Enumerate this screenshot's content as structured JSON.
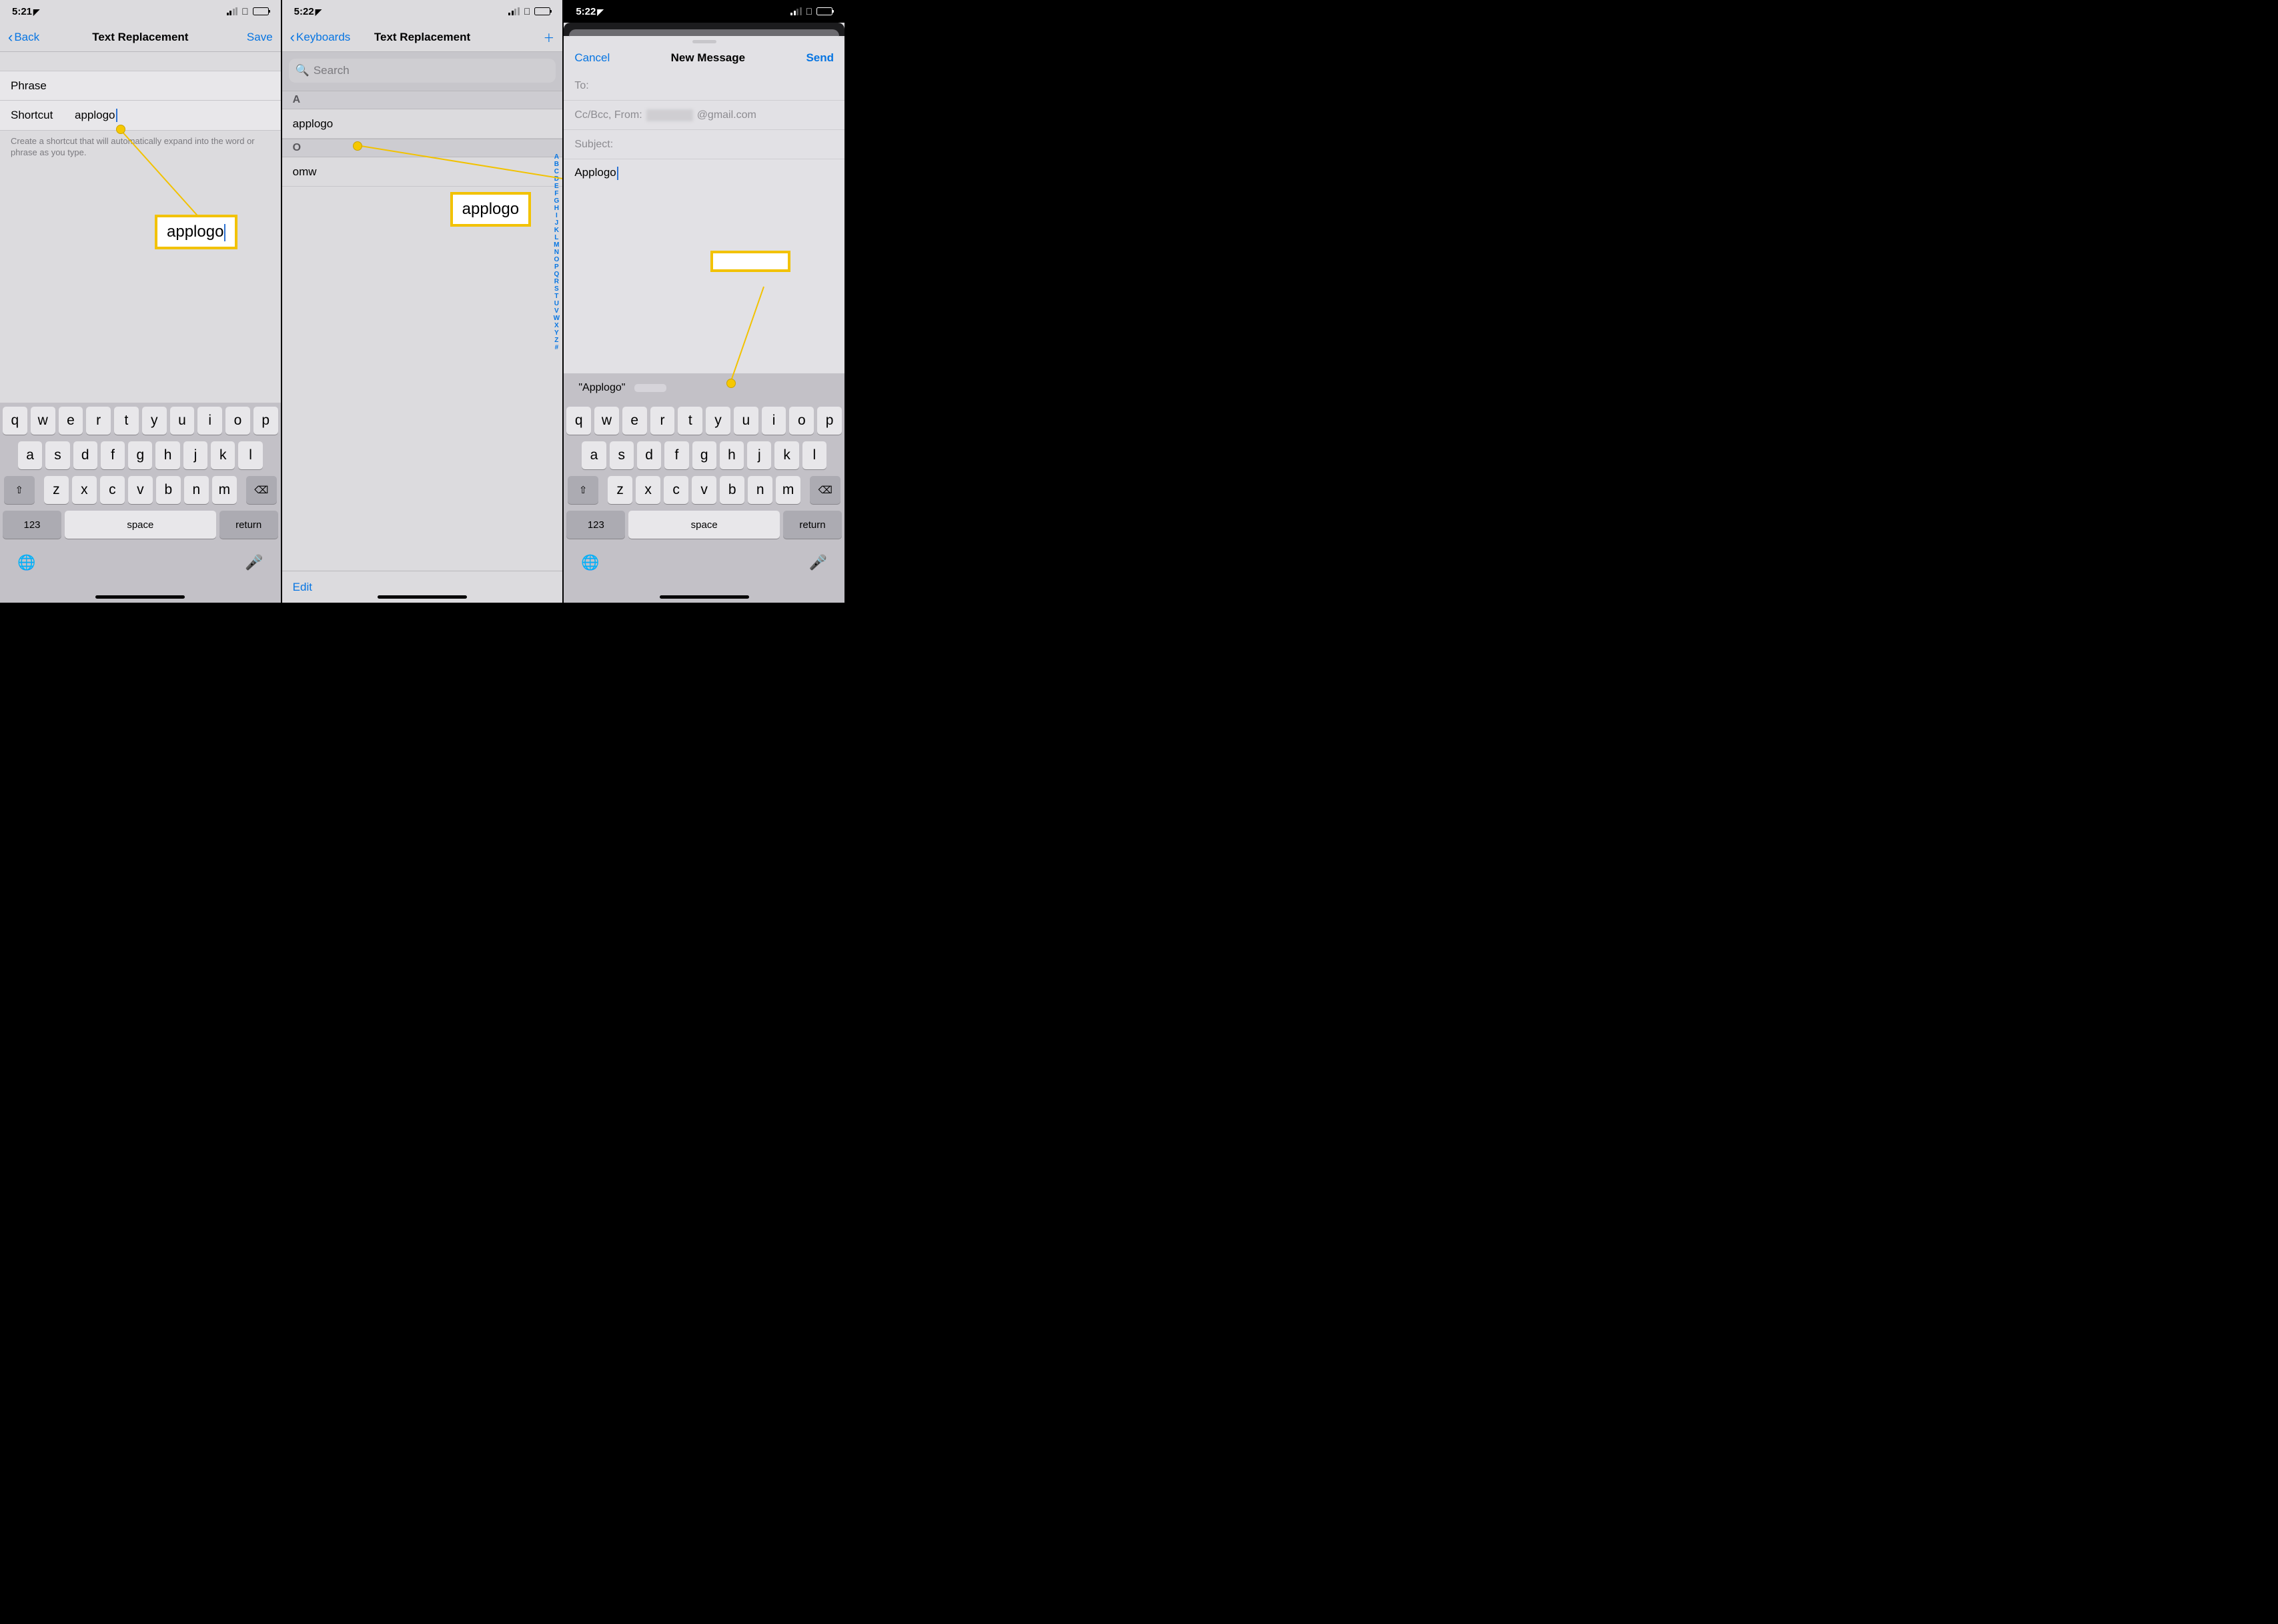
{
  "panel1": {
    "status_time": "5:21",
    "nav_back": "Back",
    "nav_title": "Text Replacement",
    "nav_save": "Save",
    "label_phrase": "Phrase",
    "value_phrase": "",
    "label_shortcut": "Shortcut",
    "value_shortcut": "applogo",
    "hint": "Create a shortcut that will automatically expand into the word or phrase as you type.",
    "callout_text": "applogo"
  },
  "panel2": {
    "status_time": "5:22",
    "nav_back": "Keyboards",
    "nav_title": "Text Replacement",
    "search_placeholder": "Search",
    "sections": [
      {
        "letter": "A",
        "rows": [
          {
            "shortcut": "applogo",
            "phrase": ""
          }
        ]
      },
      {
        "letter": "O",
        "rows": [
          {
            "shortcut": "omw",
            "phrase": ""
          }
        ]
      }
    ],
    "edit": "Edit",
    "index": [
      "A",
      "B",
      "C",
      "D",
      "E",
      "F",
      "G",
      "H",
      "I",
      "J",
      "K",
      "L",
      "M",
      "N",
      "O",
      "P",
      "Q",
      "R",
      "S",
      "T",
      "U",
      "V",
      "W",
      "X",
      "Y",
      "Z",
      "#"
    ],
    "callout_text": "applogo"
  },
  "panel3": {
    "status_time": "5:22",
    "cancel": "Cancel",
    "title": "New Message",
    "send": "Send",
    "to_label": "To:",
    "cc_label": "Cc/Bcc, From:",
    "cc_value_suffix": "@gmail.com",
    "subject_label": "Subject:",
    "body_text": "Applogo",
    "qt_original": "\"Applogo\"",
    "qt_suggestion": ""
  },
  "keyboard": {
    "row1": [
      "q",
      "w",
      "e",
      "r",
      "t",
      "y",
      "u",
      "i",
      "o",
      "p"
    ],
    "row2": [
      "a",
      "s",
      "d",
      "f",
      "g",
      "h",
      "j",
      "k",
      "l"
    ],
    "row3": [
      "z",
      "x",
      "c",
      "v",
      "b",
      "n",
      "m"
    ],
    "k123": "123",
    "space": "space",
    "return": "return"
  }
}
